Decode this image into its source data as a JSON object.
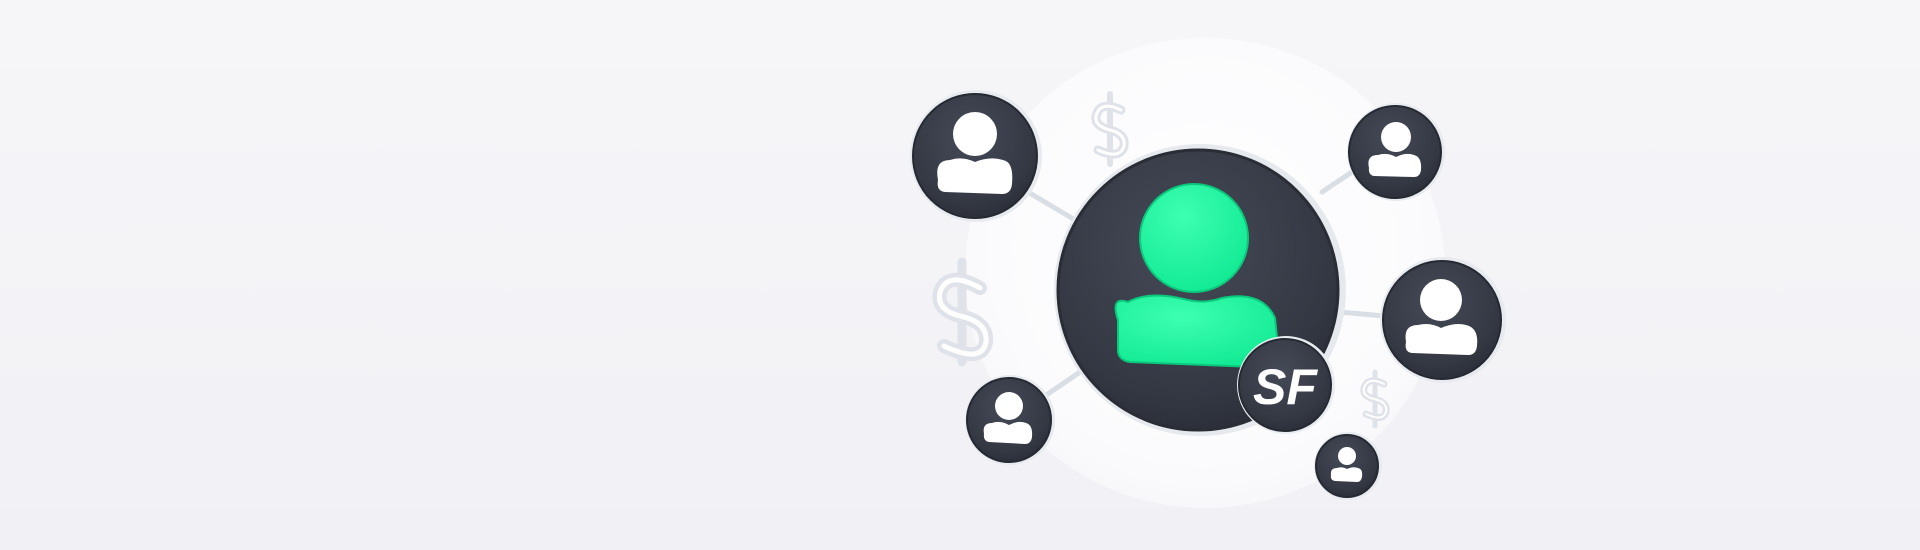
{
  "colors": {
    "background": "#f3f3f7",
    "node_dark": "#363a45",
    "node_dark_edge": "#262932",
    "accent_green": "#11f59a",
    "glass_line": "#d8dde3",
    "user_icon_fill": "#ffffff"
  },
  "badge": {
    "label": "SF"
  },
  "icons": {
    "central": "user-icon",
    "satellites": [
      "user-icon",
      "user-icon",
      "user-icon",
      "user-icon",
      "user-icon"
    ],
    "currency": [
      "dollar-sign-icon",
      "dollar-sign-icon",
      "dollar-sign-icon"
    ]
  }
}
